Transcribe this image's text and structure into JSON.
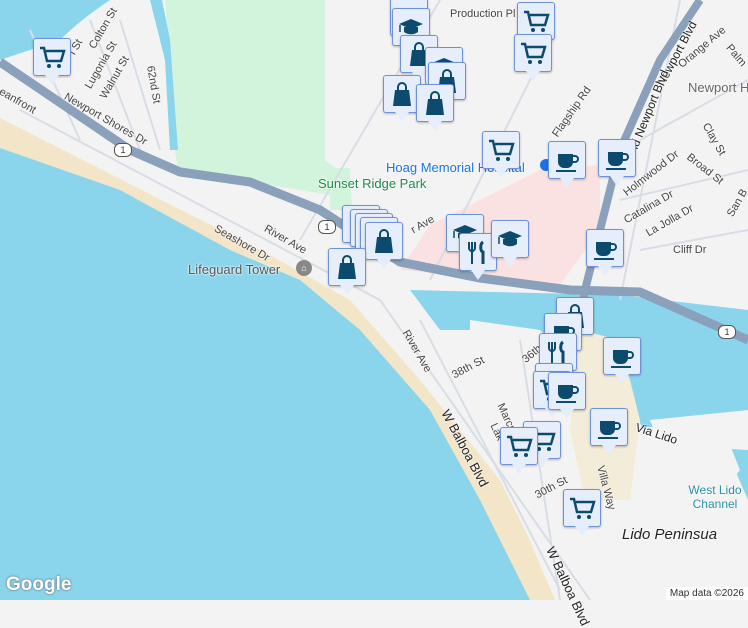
{
  "map": {
    "colors": {
      "water": "#8ad4ec",
      "land": "#f4f3f4",
      "park": "#d2f4dc",
      "beach": "#f3e6c8",
      "highway": "#8aa0bb",
      "hospital": "#fbe2e2",
      "marker_bg": "#e6eefb",
      "marker_icon": "#0c4a6e"
    },
    "labels": {
      "colton": "Colton St",
      "lugonia": "Lugonia St",
      "walnut": "Walnut St",
      "st62": "62nd St",
      "oceanfront": "eanfront",
      "newport_shores": "Newport Shores Dr",
      "partial_st": "l St",
      "seashore": "Seashore Dr",
      "river_ave": "River Ave",
      "river_ave2": "River Ave",
      "production": "Production Pl",
      "flagship": "Flagship Rd",
      "newport_blvd": "Newport Blvd",
      "old_newport": "Old Newport Blvd",
      "orange": "Orange Ave",
      "clay": "Clay St",
      "broad": "Broad St",
      "holmwood": "Holmwood Dr",
      "catalina": "Catalina Dr",
      "lajolla": "La Jolla Dr",
      "cliff": "Cliff Dr",
      "sanb": "San B",
      "palm": "Palm",
      "ave_partial": "r Ave",
      "st38": "38th St",
      "st36": "36th",
      "marcus": "Marcus",
      "lake": "Lak",
      "balboa1": "W Balboa Blvd",
      "balboa2": "W Balboa Blvd",
      "st30": "30th St",
      "via_lido": "Via Lido",
      "villa_way": "Villa Way",
      "sunset_park": "Sunset Ridge Park",
      "lifeguard": "Lifeguard Tower",
      "hoag": "Hoag Memorial Hospital",
      "newport_elem": "Newport H Elem",
      "west_lido": "West Lido Channel",
      "lido_pen": "Lido Peninsua"
    },
    "route_shield": "1",
    "attribution": "Map data ©2026",
    "logo": "Google",
    "markers": [
      "cart",
      "school",
      "school",
      "bag",
      "school",
      "bag",
      "bag",
      "bag",
      "cart",
      "cart",
      "cart",
      "coffee",
      "coffee",
      "restaurant",
      "restaurant",
      "restaurant",
      "restaurant",
      "bag",
      "bag",
      "school",
      "restaurant",
      "school",
      "coffee",
      "bag",
      "coffee",
      "restaurant",
      "restaurant",
      "cart",
      "coffee",
      "coffee",
      "coffee",
      "cart",
      "cart",
      "cart"
    ]
  }
}
